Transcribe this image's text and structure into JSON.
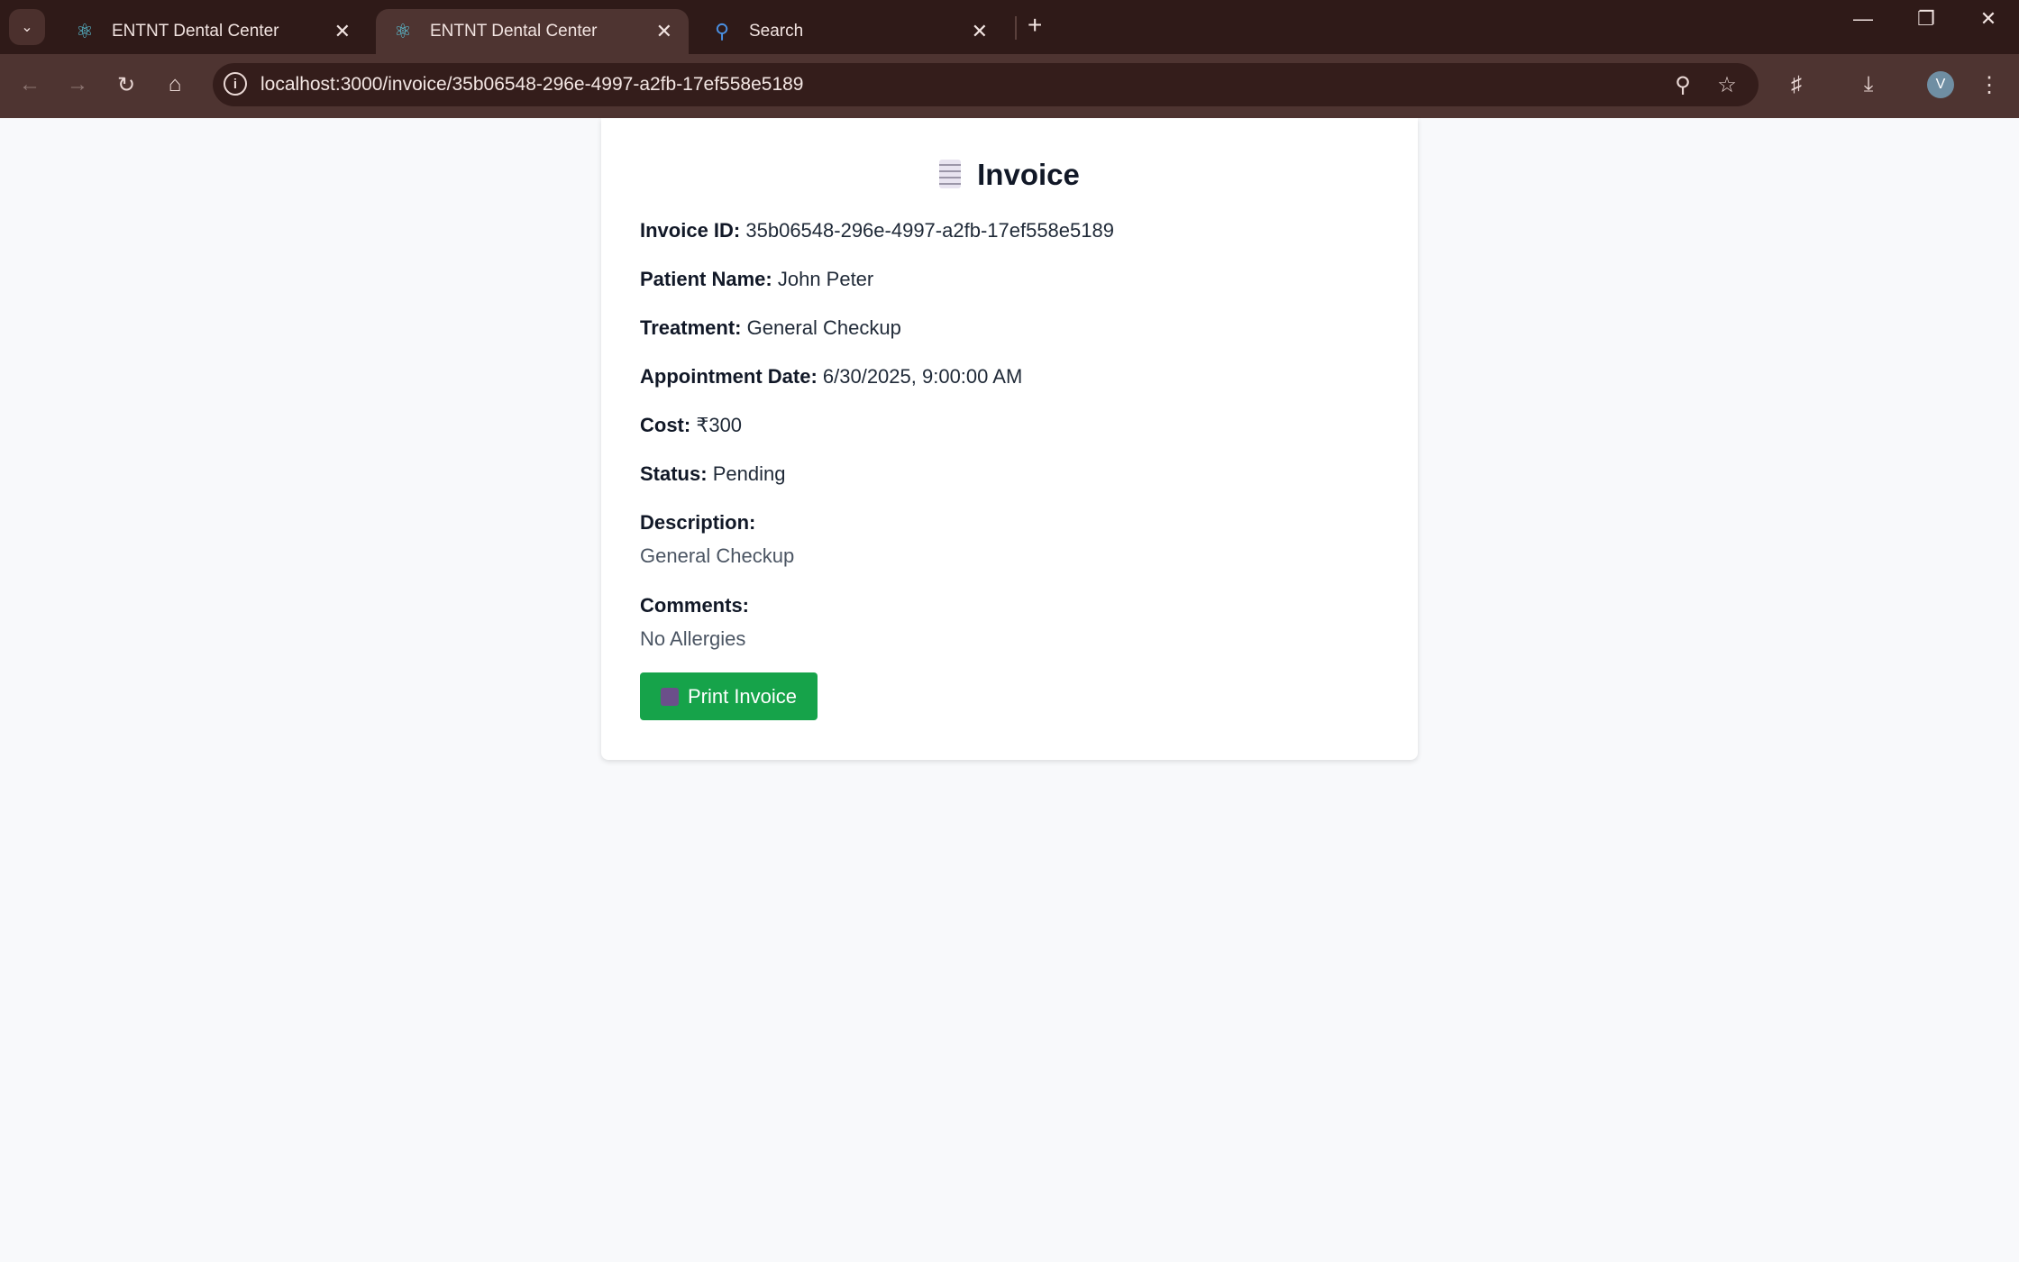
{
  "browser": {
    "tabs": [
      {
        "title": "ENTNT Dental Center",
        "icon": "react-icon",
        "active": false
      },
      {
        "title": "ENTNT Dental Center",
        "icon": "react-icon",
        "active": true
      },
      {
        "title": "Search",
        "icon": "search-icon",
        "active": false
      }
    ],
    "url": "localhost:3000/invoice/35b06548-296e-4997-a2fb-17ef558e5189",
    "profile_initial": "V"
  },
  "invoice": {
    "title": "Invoice",
    "fields": [
      {
        "label": "Invoice ID:",
        "value": "35b06548-296e-4997-a2fb-17ef558e5189"
      },
      {
        "label": "Patient Name:",
        "value": "John Peter"
      },
      {
        "label": "Treatment:",
        "value": "General Checkup"
      },
      {
        "label": "Appointment Date:",
        "value": "6/30/2025, 9:00:00 AM"
      },
      {
        "label": "Cost:",
        "value": "₹300"
      },
      {
        "label": "Status:",
        "value": "Pending"
      }
    ],
    "description_label": "Description:",
    "description": "General Checkup",
    "comments_label": "Comments:",
    "comments": "No Allergies",
    "print_label": "Print Invoice"
  },
  "colors": {
    "primary_button": "#16a34a"
  }
}
